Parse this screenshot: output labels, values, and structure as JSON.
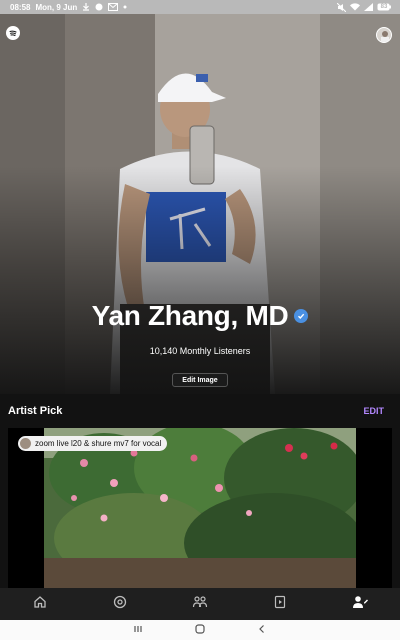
{
  "status_bar": {
    "time": "08:58",
    "date": "Mon, 9 Jun",
    "battery": "83"
  },
  "artist": {
    "name": "Yan Zhang, MD",
    "listeners": "10,140 Monthly Listeners",
    "edit_image_label": "Edit Image"
  },
  "artist_pick": {
    "title": "Artist Pick",
    "edit_label": "EDIT",
    "badge_text": "zoom live l20 & shure mv7 for vocal"
  },
  "bottom_nav": {
    "items": [
      "home-icon",
      "radio-icon",
      "community-icon",
      "media-icon",
      "profile-icon"
    ],
    "active": "profile-icon"
  },
  "system_nav": {
    "items": [
      "recents-icon",
      "home-icon",
      "back-icon"
    ]
  },
  "colors": {
    "accent": "#b388ff",
    "verified": "#4a90e2",
    "background": "#121212"
  }
}
